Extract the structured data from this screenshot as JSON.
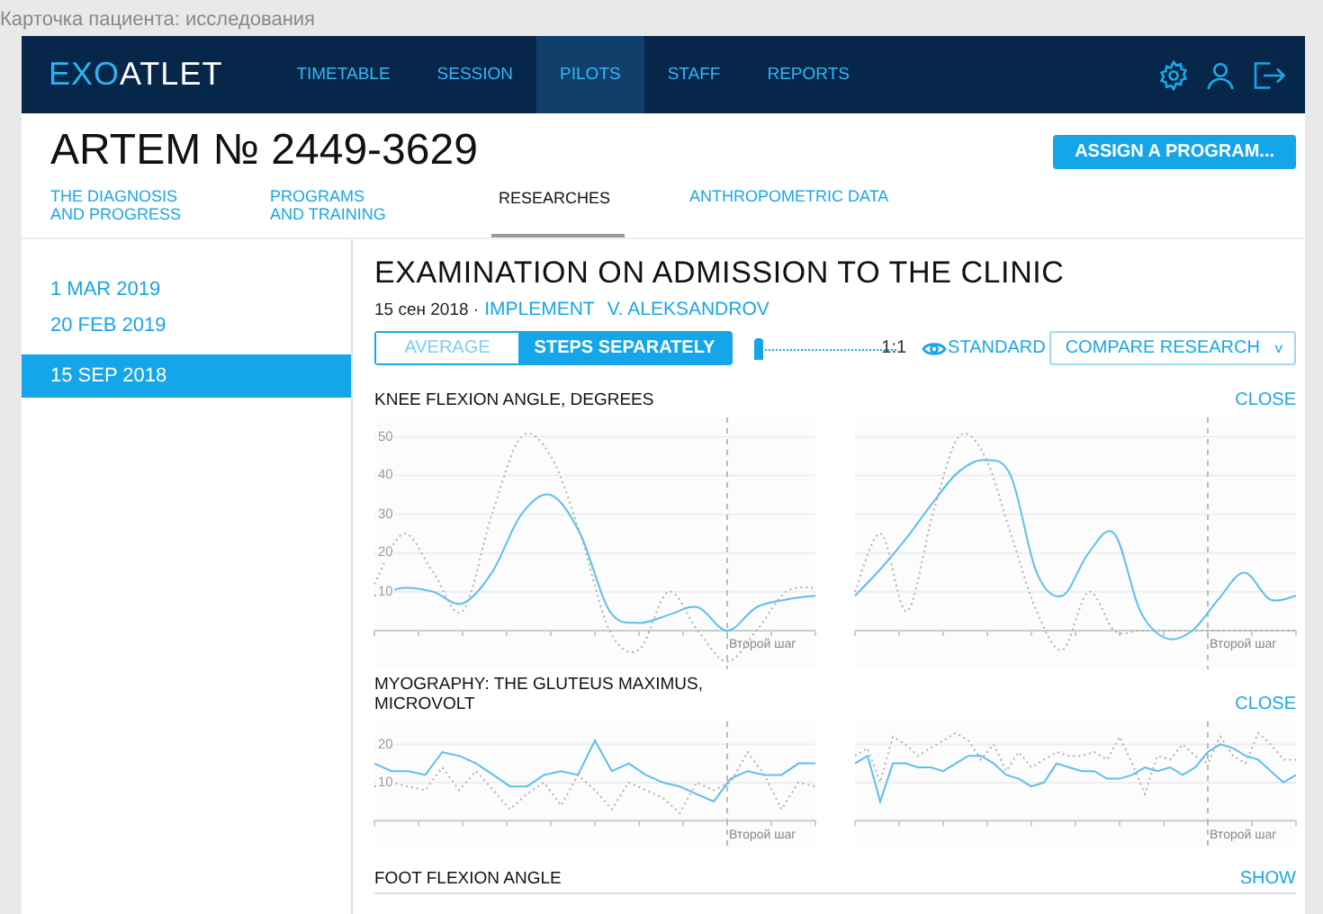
{
  "window": {
    "title": "Карточка пациента: исследования"
  },
  "nav": {
    "logo": {
      "accent": "EXO",
      "rest": "ATLET"
    },
    "items": [
      {
        "label": "TIMETABLE",
        "selected": false
      },
      {
        "label": "SESSION",
        "selected": false
      },
      {
        "label": "PILOTS",
        "selected": true
      },
      {
        "label": "STAFF",
        "selected": false
      },
      {
        "label": "REPORTS",
        "selected": false
      }
    ]
  },
  "patient": {
    "name": "ARTEM № 2449-3629",
    "action": "ASSIGN A PROGRAM..."
  },
  "tabs": [
    {
      "label": "THE DIAGNOSIS\nAND PROGRESS",
      "selected": false
    },
    {
      "label": "PROGRAMS\nAND TRAINING",
      "selected": false
    },
    {
      "label": "RESEARCHES",
      "selected": true
    },
    {
      "label": "ANTHROPOMETRIC DATA",
      "selected": false
    }
  ],
  "dates": [
    {
      "label": "1 MAR 2019",
      "selected": false
    },
    {
      "label": "20 FEB 2019",
      "selected": false
    },
    {
      "label": "15 SEP 2018",
      "selected": true
    }
  ],
  "examination": {
    "title": "EXAMINATION ON ADMISSION TO THE CLINIC",
    "date": "15 сен 2018 ·",
    "kind": "IMPLEMENT",
    "doctor": "V. ALEKSANDROV"
  },
  "toolbar": {
    "modes": [
      {
        "label": "AVERAGE",
        "selected": false
      },
      {
        "label": "STEPS SEPARATELY",
        "selected": true
      }
    ],
    "scale": {
      "level": 0,
      "reading": "1:1"
    },
    "standard": {
      "label": "STANDARD",
      "on": true
    },
    "compare": {
      "label": "COMPARE RESEARCH",
      "caret": "˅"
    }
  },
  "sections": [
    {
      "title": "KNEE FLEXION ANGLE, DEGREES",
      "action": "CLOSE",
      "graph": {
        "kind": "smooth",
        "y_labels": [
          "50",
          "40",
          "30",
          "20",
          "10"
        ],
        "marker_label": "Второй шаг",
        "compare_marker_label": "Второй шаг"
      }
    },
    {
      "title": "MYOGRAPHY: THE GLUTEUS MAXIMUS,\nMICROVOLT",
      "action": "CLOSE",
      "graph": {
        "kind": "jagged",
        "y_labels": [
          "20",
          "10"
        ],
        "marker_label": "Второй шаг",
        "compare_marker_label": "Второй шаг"
      }
    },
    {
      "title": "FOOT FLEXION ANGLE",
      "action": "SHOW"
    }
  ]
}
